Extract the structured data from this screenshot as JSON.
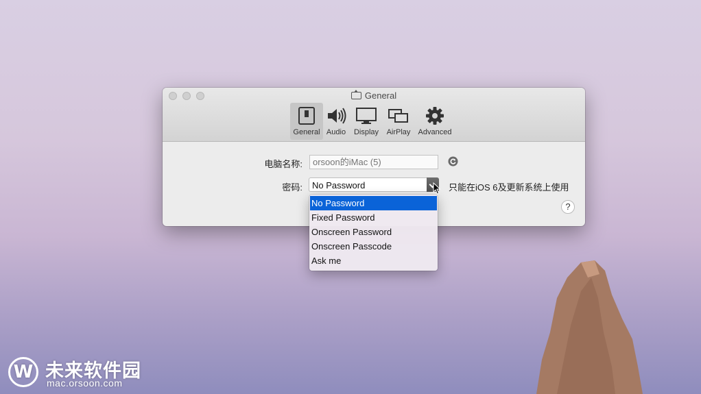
{
  "window": {
    "title": "General",
    "tabs": [
      {
        "label": "General",
        "icon": "general-switch-icon",
        "selected": true
      },
      {
        "label": "Audio",
        "icon": "speaker-icon",
        "selected": false
      },
      {
        "label": "Display",
        "icon": "monitor-icon",
        "selected": false
      },
      {
        "label": "AirPlay",
        "icon": "airplay-icon",
        "selected": false
      },
      {
        "label": "Advanced",
        "icon": "gear-icon",
        "selected": false
      }
    ]
  },
  "form": {
    "computer_name_label": "电脑名称:",
    "computer_name_placeholder": "orsoon的iMac (5)",
    "password_label": "密码:",
    "password_value": "No Password",
    "password_note": "只能在iOS 6及更新系统上使用",
    "help_label": "?"
  },
  "dropdown": {
    "options": [
      "No Password",
      "Fixed Password",
      "Onscreen Password",
      "Onscreen Passcode",
      "Ask me"
    ],
    "highlighted_index": 0
  },
  "watermark": {
    "logo_letter": "W",
    "title": "未来软件园",
    "url": "mac.orsoon.com"
  },
  "colors": {
    "highlight": "#0a63d8",
    "window_bg": "#ececec"
  }
}
